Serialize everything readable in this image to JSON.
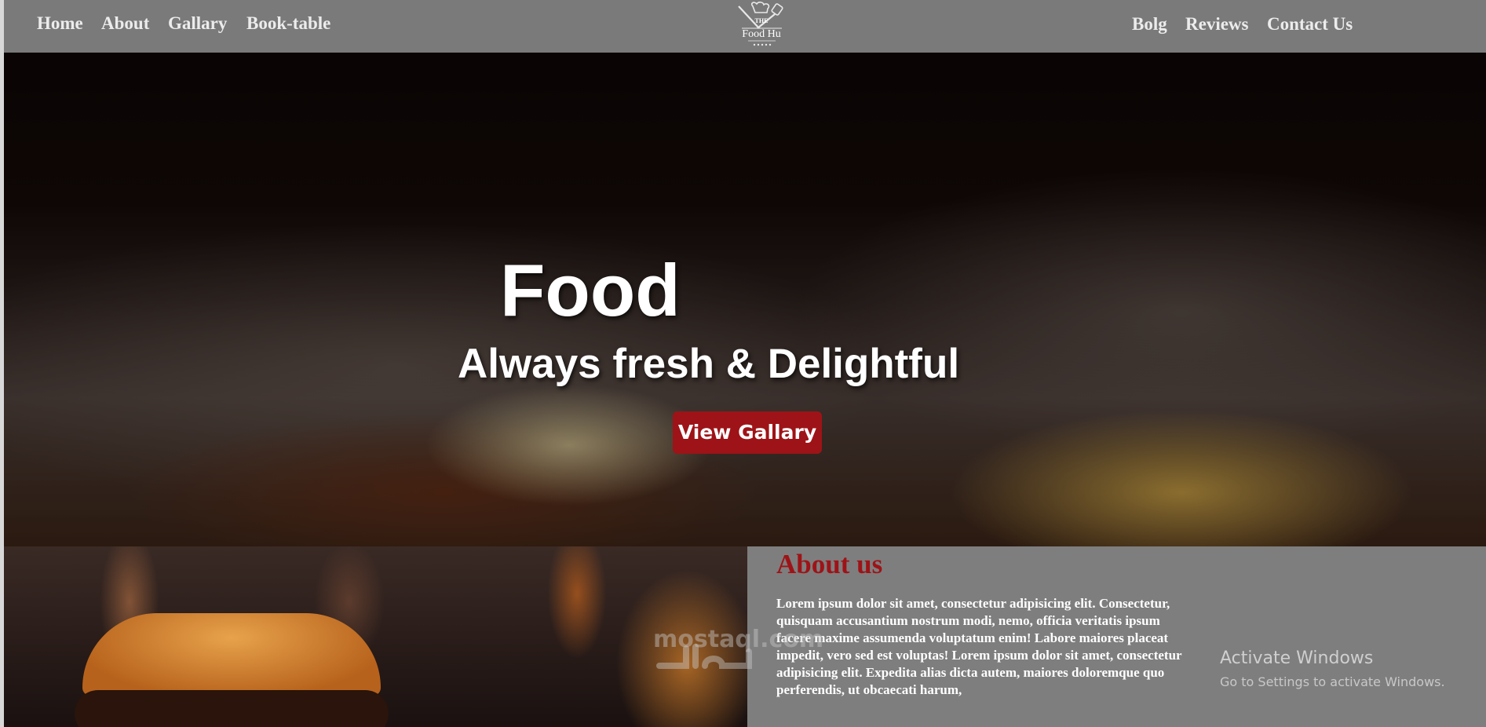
{
  "nav": {
    "left": [
      {
        "label": "Home"
      },
      {
        "label": "About"
      },
      {
        "label": "Gallary"
      },
      {
        "label": "Book-table"
      }
    ],
    "right": [
      {
        "label": "Bolg"
      },
      {
        "label": "Reviews"
      },
      {
        "label": "Contact Us"
      }
    ],
    "logo": {
      "top": "THE",
      "name": "Food Hu"
    }
  },
  "hero": {
    "title": "Food",
    "subtitle": "Always fresh & Delightful",
    "button": "View Gallary"
  },
  "about": {
    "title": "About us",
    "text": "Lorem ipsum dolor sit amet, consectetur adipisicing elit. Consectetur, quisquam accusantium nostrum modi, nemo, officia veritatis ipsum facere maxime assumenda voluptatum enim! Labore maiores placeat impedit, vero sed est voluptas! Lorem ipsum dolor sit amet, consectetur adipisicing elit. Expedita alias dicta autem, maiores doloremque quo perferendis, ut obcaecati harum,"
  },
  "overlay": {
    "watermark": "mostaql.com",
    "activate_title": "Activate Windows",
    "activate_sub": "Go to Settings to activate Windows."
  },
  "colors": {
    "accent": "#9e1317",
    "nav_bg": "#7a7a7a",
    "about_bg": "#7e7e7e"
  }
}
